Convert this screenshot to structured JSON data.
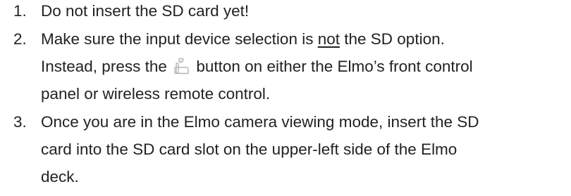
{
  "steps": [
    {
      "number": "1.",
      "lines": [
        "Do not insert the SD card yet!"
      ]
    },
    {
      "number": "2.",
      "line1_before": "Make sure the input device selection is ",
      "line1_emphasis": "not",
      "line1_after": " the SD option.",
      "line2_before": "Instead, press the ",
      "line2_after": " button on either the Elmo’s front control",
      "line3": "panel or wireless remote control."
    },
    {
      "number": "3.",
      "lines": [
        "Once you are in the Elmo camera viewing mode, insert the SD",
        "card into the SD card slot on the upper-left side of the Elmo",
        "deck."
      ]
    }
  ],
  "icons": {
    "camera_button": "document-camera-icon"
  }
}
